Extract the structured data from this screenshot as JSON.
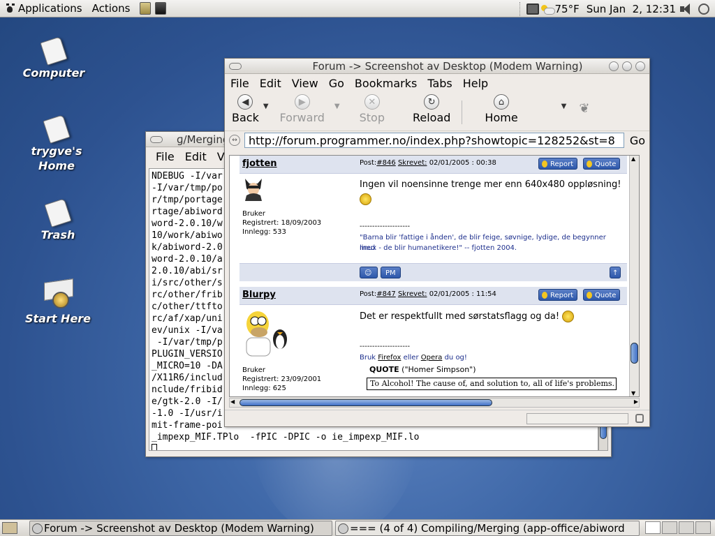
{
  "top_panel": {
    "menus": [
      "Applications",
      "Actions"
    ],
    "weather": "75°F",
    "clock": "Sun Jan  2, 12:31"
  },
  "desktop_icons": [
    {
      "label": "Computer"
    },
    {
      "label": "trygve's\nHome",
      "line1": "trygve's",
      "line2": "Home"
    },
    {
      "label": "Trash"
    },
    {
      "label": "Start Here"
    }
  ],
  "terminal": {
    "title": "ɡ/Merging (",
    "menus": [
      "File",
      "Edit",
      "V"
    ],
    "lines": [
      "NDEBUG -I/var",
      "-I/var/tmp/po",
      "r/tmp/portage",
      "rtage/abiword",
      "word-2.0.10/w",
      "10/work/abiwo",
      "k/abiword-2.0",
      "word-2.0.10/a",
      "2.0.10/abi/sr",
      "i/src/other/s",
      "rc/other/frib",
      "c/other/ttfto",
      "rc/af/xap/uni",
      "ev/unix -I/va",
      " -I/var/tmp/p",
      "PLUGIN_VERSIO",
      "_MICRO=10 -DA",
      "/X11R6/includ",
      "nclude/fribid",
      "e/gtk-2.0 -I/",
      "-1.0 -I/usr/i",
      "mit-frame-poi",
      "_impexp_MIF.TPlo  -fPIC -DPIC -o ie_impexp_MIF.lo"
    ]
  },
  "browser": {
    "title": "Forum -> Screenshot av Desktop (Modem Warning)",
    "menus": [
      "File",
      "Edit",
      "View",
      "Go",
      "Bookmarks",
      "Tabs",
      "Help"
    ],
    "toolbar": {
      "back": "Back",
      "forward": "Forward",
      "stop": "Stop",
      "reload": "Reload",
      "home": "Home"
    },
    "url": "http://forum.programmer.no/index.php?showtopic=128252&st=8",
    "go": "Go"
  },
  "posts": [
    {
      "author": "fjotten",
      "post_label": "Post:",
      "post_no": "#846",
      "written_label": "Skrevet:",
      "date": "02/01/2005 : 00:38",
      "report": "Report",
      "quote": "Quote",
      "role": "Bruker",
      "registered": "Registrert: 18/09/2003",
      "posts_count": "Innlegg: 533",
      "text": "Ingen vil noensinne trenge mer enn 640x480 oppløsning!",
      "sig_sep": "--------------------",
      "sig_line1": "\"Barna blir 'fattige i ånden', de blir feige, søvnige, lydige, de begynner med",
      "sig_line2": "linux - de blir humanetikere!\" -- fjotten 2004.",
      "pm": "PM"
    },
    {
      "author": "Blurpy",
      "post_label": "Post:",
      "post_no": "#847",
      "written_label": "Skrevet:",
      "date": "02/01/2005 : 11:54",
      "report": "Report",
      "quote": "Quote",
      "role": "Bruker",
      "registered": "Registrert: 23/09/2001",
      "posts_count": "Innlegg: 625",
      "text": "Det er respektfullt med sørstatsflagg og da!",
      "sig_sep": "--------------------",
      "sig_a": "Bruk",
      "sig_firefox": "Firefox",
      "sig_b": "eller",
      "sig_opera": "Opera",
      "sig_c": "du og!",
      "quote_title": "QUOTE",
      "quote_source": "(\"Homer Simpson\")",
      "quote_text": "To Alcohol! The cause of, and solution to, all of life's problems."
    }
  ],
  "bottom_panel": {
    "tasks": [
      "Forum -> Screenshot av Desktop (Modem Warning)",
      "=== (4 of 4) Compiling/Merging (app-office/abiword"
    ]
  }
}
